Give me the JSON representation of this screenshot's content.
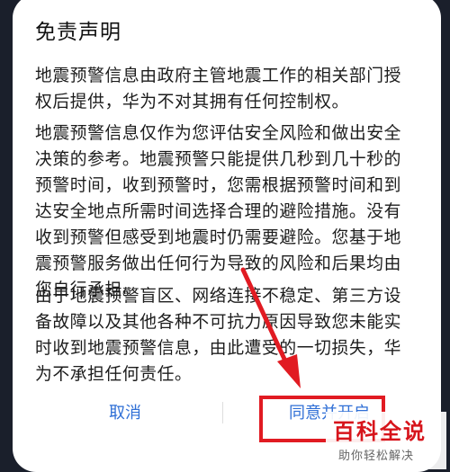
{
  "dialog": {
    "title": "免责声明",
    "paragraphs": [
      "地震预警信息由政府主管地震工作的相关部门授权后提供，华为不对其拥有任何控制权。",
      "地震预警信息仅作为您评估安全风险和做出安全决策的参考。地震预警只能提供几秒到几十秒的预警时间，收到预警时，您需根据预警时间和到达安全地点所需时间选择合理的避险措施。没有收到预警但感受到地震时仍需要避险。您基于地震预警服务做出任何行为导致的风险和后果均由您自行承担。",
      "由于地震预警盲区、网络连接不稳定、第三方设备故障以及其他各种不可抗力原因导致您未能实时收到地震预警信息，由此遭受的一切损失，华为不承担任何责任。"
    ],
    "cancel_label": "取消",
    "agree_label": "同意并开启"
  },
  "watermark": {
    "main": "百科全说",
    "sub": "助你轻松解决"
  },
  "colors": {
    "accent": "#2f6fd6",
    "annotation": "#e11b22"
  }
}
